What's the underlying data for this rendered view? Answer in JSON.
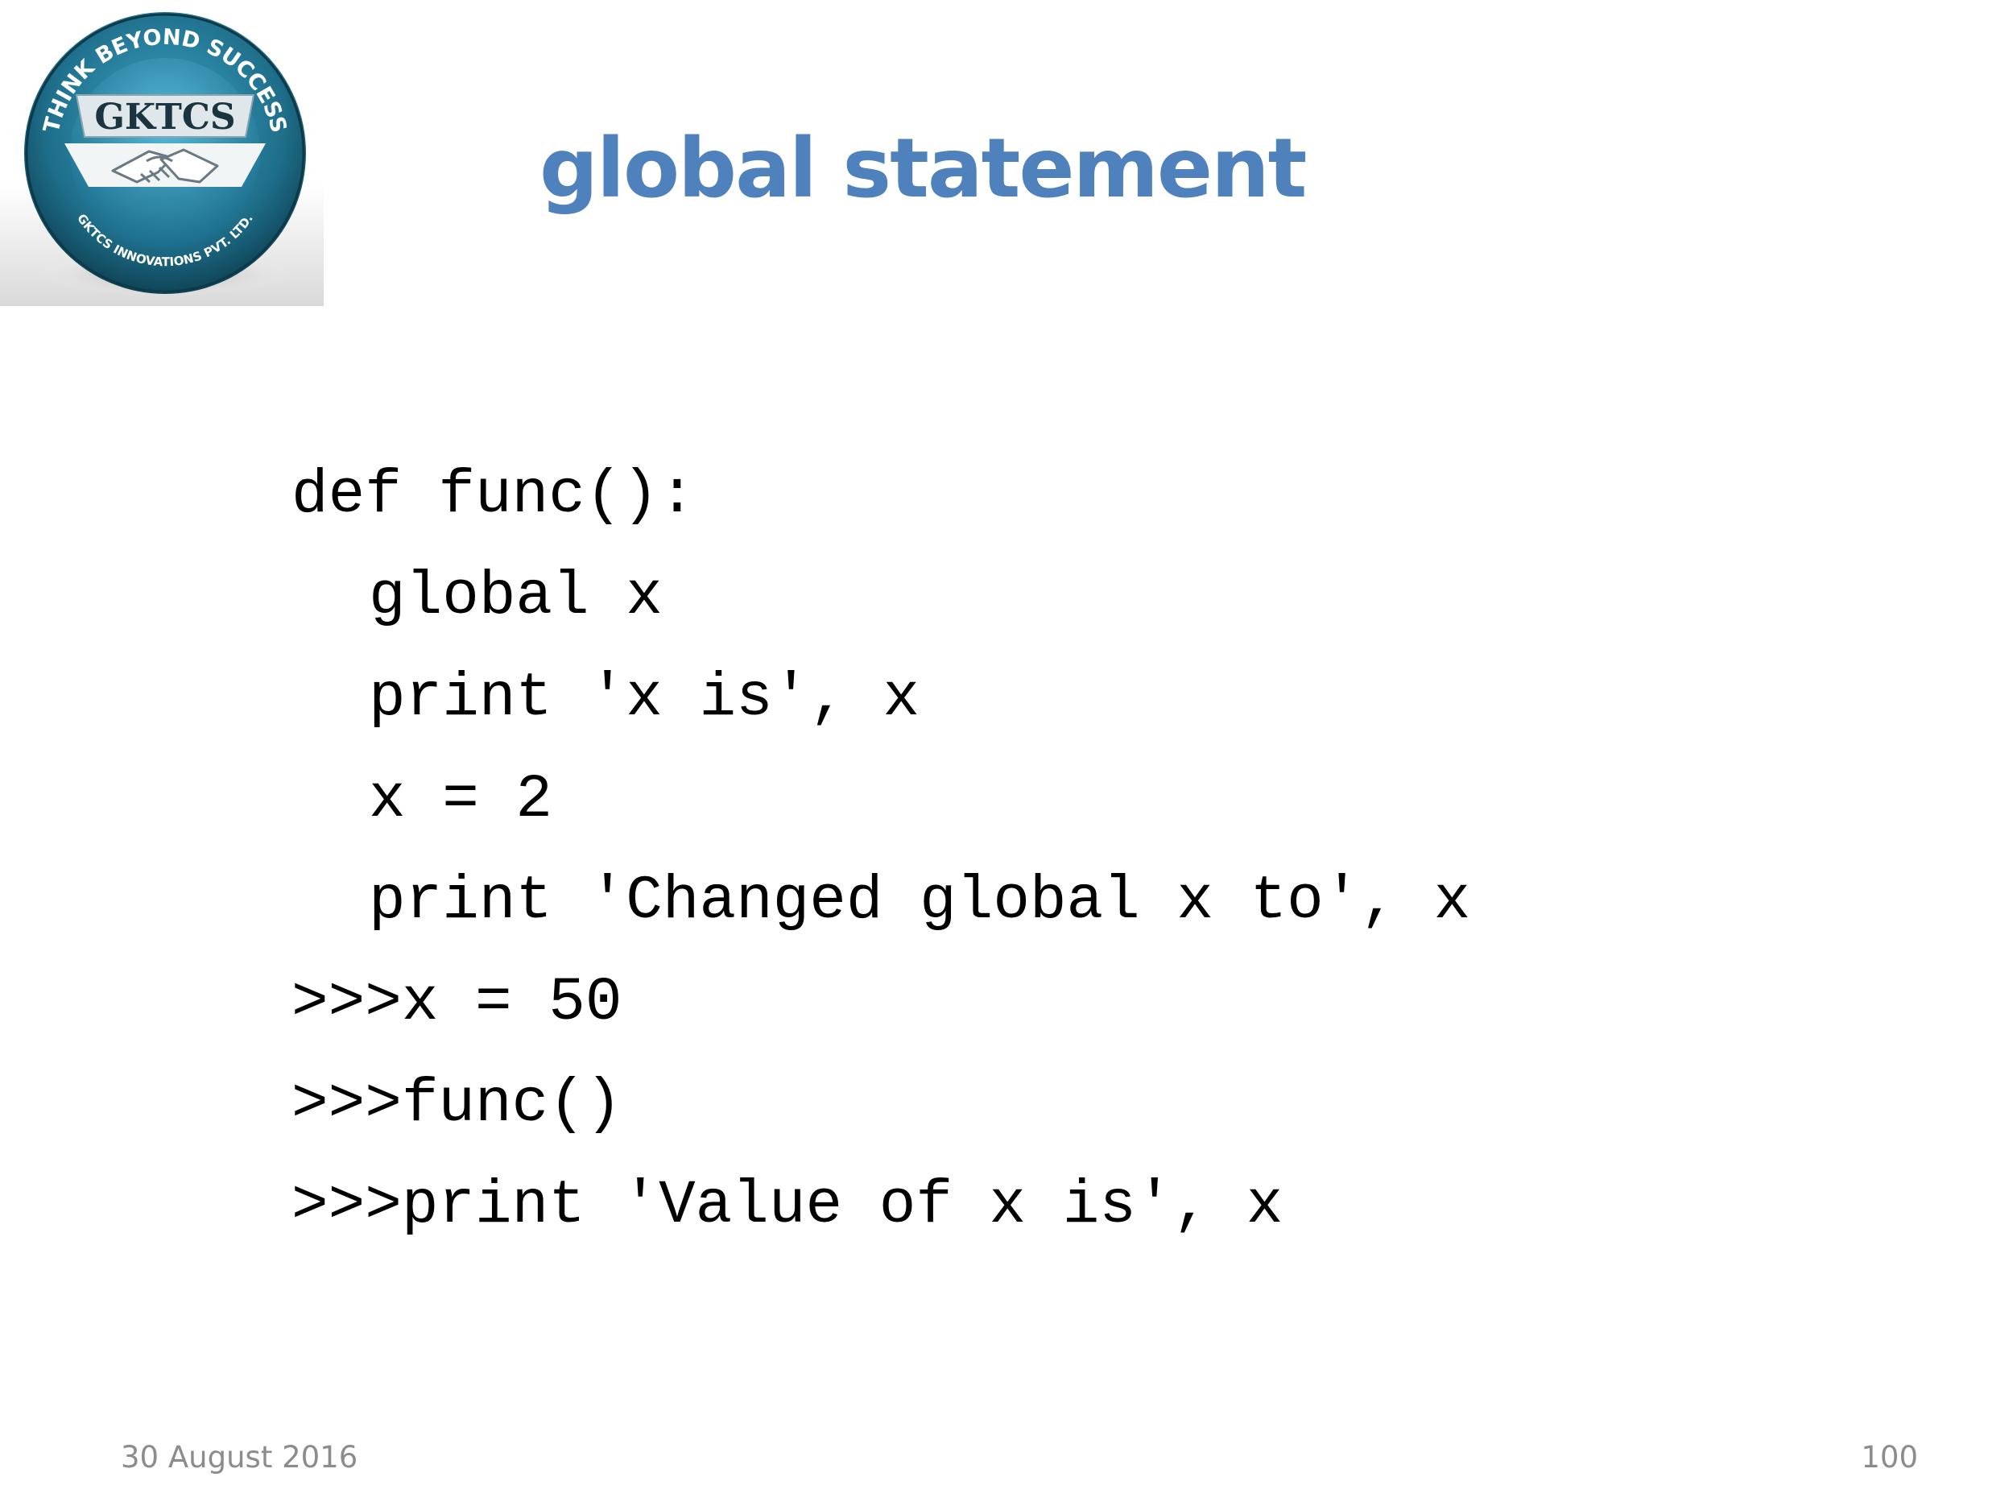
{
  "slide": {
    "title": "global statement",
    "logo": {
      "name": "GKTCS",
      "top_arc_text": "THINK BEYOND SUCCESS",
      "bottom_arc_text": "GKTCS INNOVATIONS PVT. LTD.",
      "icon": "handshake-icon",
      "ring_color": "#1f6f8b",
      "inner_color": "#2b93b6",
      "band_color": "#dfe7ea"
    },
    "code_lines": [
      "def func():",
      "global x",
      "print 'x is', x",
      "x = 2",
      "print 'Changed global x to', x",
      ">>>x = 50",
      ">>>func()",
      ">>>print 'Value of x is', x"
    ],
    "footer": {
      "date": "30 August 2016",
      "page_number": "100"
    },
    "colors": {
      "title": "#4f81bd",
      "footer_text": "#8c8c8c",
      "code_text": "#000000"
    }
  }
}
